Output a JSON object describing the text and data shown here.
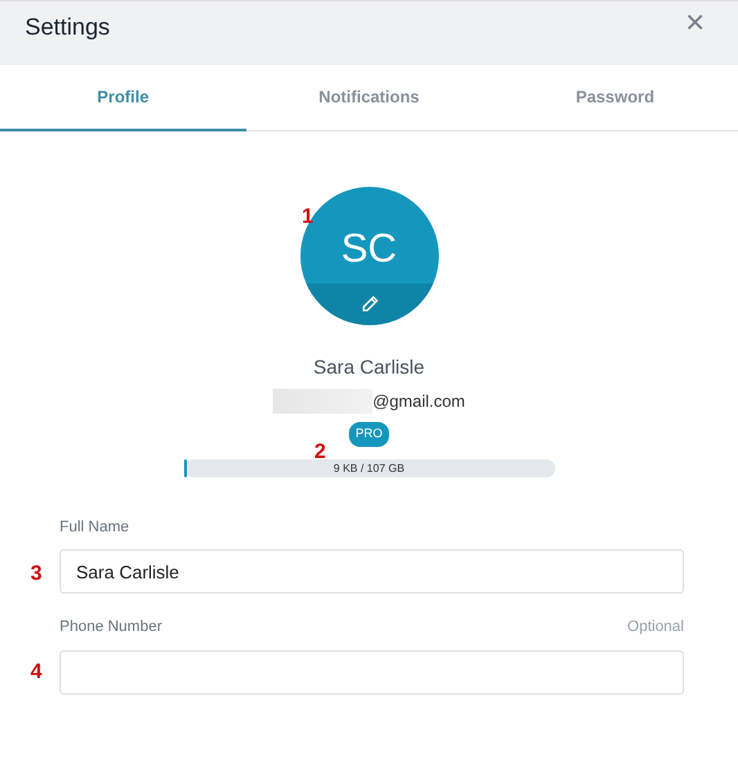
{
  "dialog": {
    "title": "Settings",
    "close": "×"
  },
  "tabs": [
    {
      "label": "Profile",
      "selected": true
    },
    {
      "label": "Notifications",
      "selected": false
    },
    {
      "label": "Password",
      "selected": false
    }
  ],
  "profile": {
    "initials": "SC",
    "name": "Sara Carlisle",
    "email_visible": "@gmail.com",
    "email_redacted": true,
    "plan": "PRO",
    "storage": {
      "level": 0.01,
      "reading": "9 KB / 107 GB"
    }
  },
  "fields": [
    {
      "label": "Full Name",
      "value": "Sara Carlisle"
    },
    {
      "label": "Phone Number",
      "hint": "Optional"
    }
  ],
  "annotations": [
    "1",
    "2",
    "3",
    "4"
  ]
}
